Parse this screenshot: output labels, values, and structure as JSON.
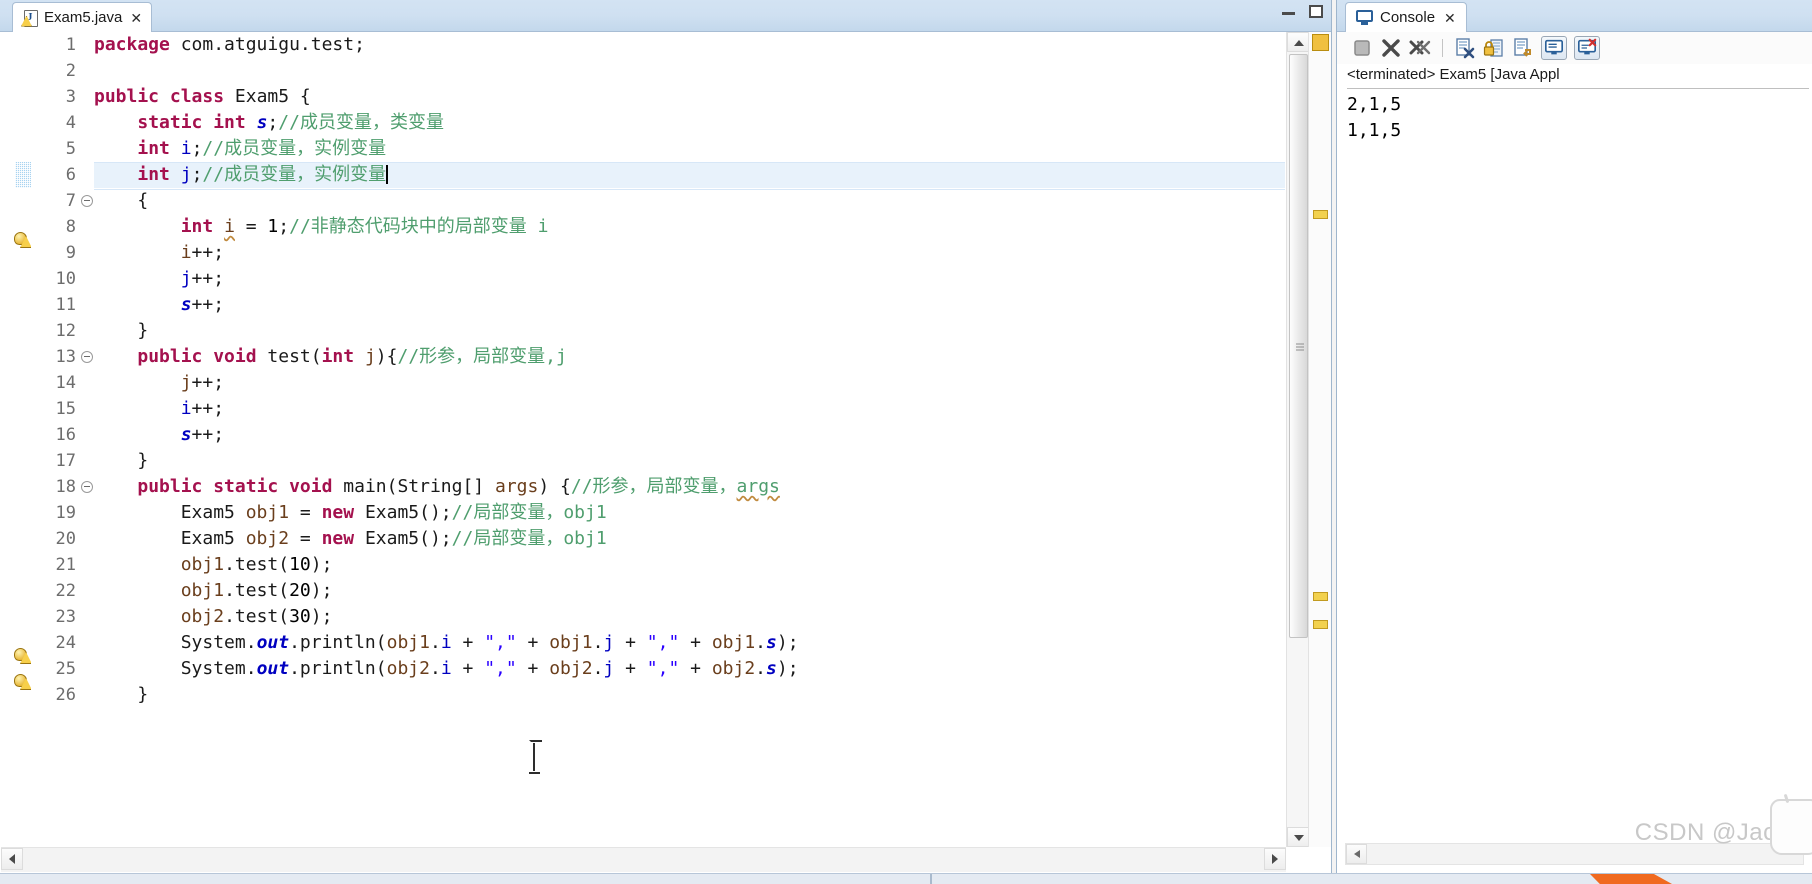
{
  "editor": {
    "tab": {
      "label": "Exam5.java",
      "close_glyph": "✕",
      "icon_letter": "J"
    },
    "window_controls": {
      "minimize": "minimize-icon",
      "maximize": "maximize-icon"
    },
    "line_numbers": [
      "1",
      "2",
      "3",
      "4",
      "5",
      "6",
      "7",
      "8",
      "9",
      "10",
      "11",
      "12",
      "13",
      "14",
      "15",
      "16",
      "17",
      "18",
      "19",
      "20",
      "21",
      "22",
      "23",
      "24",
      "25",
      "26"
    ],
    "lines": [
      {
        "n": "1",
        "tokens": [
          {
            "t": "package ",
            "c": "kw"
          },
          {
            "t": "com.atguigu.test;",
            "c": "plain"
          }
        ]
      },
      {
        "n": "2",
        "tokens": []
      },
      {
        "n": "3",
        "tokens": [
          {
            "t": "public class ",
            "c": "kw"
          },
          {
            "t": "Exam5 {",
            "c": "plain"
          }
        ]
      },
      {
        "n": "4",
        "tokens": [
          {
            "t": "    ",
            "c": "plain"
          },
          {
            "t": "static int ",
            "c": "kw"
          },
          {
            "t": "s",
            "c": "sfld"
          },
          {
            "t": ";",
            "c": "plain"
          },
          {
            "t": "//成员变量，类变量",
            "c": "cmt-cn"
          }
        ]
      },
      {
        "n": "5",
        "tokens": [
          {
            "t": "    ",
            "c": "plain"
          },
          {
            "t": "int ",
            "c": "kw"
          },
          {
            "t": "i",
            "c": "fld"
          },
          {
            "t": ";",
            "c": "plain"
          },
          {
            "t": "//成员变量，实例变量",
            "c": "cmt-cn"
          }
        ]
      },
      {
        "n": "6",
        "tokens": [
          {
            "t": "    ",
            "c": "plain"
          },
          {
            "t": "int ",
            "c": "kw"
          },
          {
            "t": "j",
            "c": "fld"
          },
          {
            "t": ";",
            "c": "plain"
          },
          {
            "t": "//成员变量，实例变量",
            "c": "cmt-cn"
          }
        ],
        "current": true,
        "caret": true
      },
      {
        "n": "7",
        "tokens": [
          {
            "t": "    {",
            "c": "plain"
          }
        ]
      },
      {
        "n": "8",
        "tokens": [
          {
            "t": "        ",
            "c": "plain"
          },
          {
            "t": "int ",
            "c": "kw"
          },
          {
            "t": "i",
            "c": "lvar squiggle"
          },
          {
            "t": " = ",
            "c": "plain"
          },
          {
            "t": "1",
            "c": "num"
          },
          {
            "t": ";",
            "c": "plain"
          },
          {
            "t": "//非静态代码块中的局部变量 i",
            "c": "cmt-cn"
          }
        ]
      },
      {
        "n": "9",
        "tokens": [
          {
            "t": "        ",
            "c": "plain"
          },
          {
            "t": "i",
            "c": "lvar"
          },
          {
            "t": "++;",
            "c": "plain"
          }
        ]
      },
      {
        "n": "10",
        "tokens": [
          {
            "t": "        ",
            "c": "plain"
          },
          {
            "t": "j",
            "c": "fld"
          },
          {
            "t": "++;",
            "c": "plain"
          }
        ]
      },
      {
        "n": "11",
        "tokens": [
          {
            "t": "        ",
            "c": "plain"
          },
          {
            "t": "s",
            "c": "sfld"
          },
          {
            "t": "++;",
            "c": "plain"
          }
        ]
      },
      {
        "n": "12",
        "tokens": [
          {
            "t": "    }",
            "c": "plain"
          }
        ]
      },
      {
        "n": "13",
        "tokens": [
          {
            "t": "    ",
            "c": "plain"
          },
          {
            "t": "public void ",
            "c": "kw"
          },
          {
            "t": "test(",
            "c": "plain"
          },
          {
            "t": "int ",
            "c": "kw"
          },
          {
            "t": "j",
            "c": "lvar"
          },
          {
            "t": "){",
            "c": "plain"
          },
          {
            "t": "//形参，局部变量,j",
            "c": "cmt-cn"
          }
        ]
      },
      {
        "n": "14",
        "tokens": [
          {
            "t": "        ",
            "c": "plain"
          },
          {
            "t": "j",
            "c": "lvar"
          },
          {
            "t": "++;",
            "c": "plain"
          }
        ]
      },
      {
        "n": "15",
        "tokens": [
          {
            "t": "        ",
            "c": "plain"
          },
          {
            "t": "i",
            "c": "fld"
          },
          {
            "t": "++;",
            "c": "plain"
          }
        ]
      },
      {
        "n": "16",
        "tokens": [
          {
            "t": "        ",
            "c": "plain"
          },
          {
            "t": "s",
            "c": "sfld"
          },
          {
            "t": "++;",
            "c": "plain"
          }
        ]
      },
      {
        "n": "17",
        "tokens": [
          {
            "t": "    }",
            "c": "plain"
          }
        ]
      },
      {
        "n": "18",
        "tokens": [
          {
            "t": "    ",
            "c": "plain"
          },
          {
            "t": "public static void ",
            "c": "kw"
          },
          {
            "t": "main(String[] ",
            "c": "plain"
          },
          {
            "t": "args",
            "c": "lvar"
          },
          {
            "t": ") {",
            "c": "plain"
          },
          {
            "t": "//形参，局部变量，",
            "c": "cmt-cn"
          },
          {
            "t": "args",
            "c": "cmt-cn squiggle"
          }
        ]
      },
      {
        "n": "19",
        "tokens": [
          {
            "t": "        Exam5 ",
            "c": "plain"
          },
          {
            "t": "obj1",
            "c": "lvar"
          },
          {
            "t": " = ",
            "c": "plain"
          },
          {
            "t": "new ",
            "c": "kw"
          },
          {
            "t": "Exam5();",
            "c": "plain"
          },
          {
            "t": "//局部变量，obj1",
            "c": "cmt-cn"
          }
        ]
      },
      {
        "n": "20",
        "tokens": [
          {
            "t": "        Exam5 ",
            "c": "plain"
          },
          {
            "t": "obj2",
            "c": "lvar"
          },
          {
            "t": " = ",
            "c": "plain"
          },
          {
            "t": "new ",
            "c": "kw"
          },
          {
            "t": "Exam5();",
            "c": "plain"
          },
          {
            "t": "//局部变量，obj1",
            "c": "cmt-cn"
          }
        ]
      },
      {
        "n": "21",
        "tokens": [
          {
            "t": "        ",
            "c": "plain"
          },
          {
            "t": "obj1",
            "c": "lvar"
          },
          {
            "t": ".test(",
            "c": "plain"
          },
          {
            "t": "10",
            "c": "num"
          },
          {
            "t": ");",
            "c": "plain"
          }
        ]
      },
      {
        "n": "22",
        "tokens": [
          {
            "t": "        ",
            "c": "plain"
          },
          {
            "t": "obj1",
            "c": "lvar"
          },
          {
            "t": ".test(",
            "c": "plain"
          },
          {
            "t": "20",
            "c": "num"
          },
          {
            "t": ");",
            "c": "plain"
          }
        ]
      },
      {
        "n": "23",
        "tokens": [
          {
            "t": "        ",
            "c": "plain"
          },
          {
            "t": "obj2",
            "c": "lvar"
          },
          {
            "t": ".test(",
            "c": "plain"
          },
          {
            "t": "30",
            "c": "num"
          },
          {
            "t": ");",
            "c": "plain"
          }
        ]
      },
      {
        "n": "24",
        "tokens": [
          {
            "t": "        System.",
            "c": "plain"
          },
          {
            "t": "out",
            "c": "sfld"
          },
          {
            "t": ".println(",
            "c": "plain"
          },
          {
            "t": "obj1",
            "c": "lvar"
          },
          {
            "t": ".",
            "c": "plain"
          },
          {
            "t": "i",
            "c": "fld"
          },
          {
            "t": " + ",
            "c": "plain"
          },
          {
            "t": "\",\"",
            "c": "str"
          },
          {
            "t": " + ",
            "c": "plain"
          },
          {
            "t": "obj1",
            "c": "lvar"
          },
          {
            "t": ".",
            "c": "plain"
          },
          {
            "t": "j",
            "c": "fld"
          },
          {
            "t": " + ",
            "c": "plain"
          },
          {
            "t": "\",\"",
            "c": "str"
          },
          {
            "t": " + ",
            "c": "plain"
          },
          {
            "t": "obj1",
            "c": "lvar"
          },
          {
            "t": ".",
            "c": "plain"
          },
          {
            "t": "s",
            "c": "sfld"
          },
          {
            "t": ");",
            "c": "plain"
          }
        ]
      },
      {
        "n": "25",
        "tokens": [
          {
            "t": "        System.",
            "c": "plain"
          },
          {
            "t": "out",
            "c": "sfld"
          },
          {
            "t": ".println(",
            "c": "plain"
          },
          {
            "t": "obj2",
            "c": "lvar"
          },
          {
            "t": ".",
            "c": "plain"
          },
          {
            "t": "i",
            "c": "fld"
          },
          {
            "t": " + ",
            "c": "plain"
          },
          {
            "t": "\",\"",
            "c": "str"
          },
          {
            "t": " + ",
            "c": "plain"
          },
          {
            "t": "obj2",
            "c": "lvar"
          },
          {
            "t": ".",
            "c": "plain"
          },
          {
            "t": "j",
            "c": "fld"
          },
          {
            "t": " + ",
            "c": "plain"
          },
          {
            "t": "\",\"",
            "c": "str"
          },
          {
            "t": " + ",
            "c": "plain"
          },
          {
            "t": "obj2",
            "c": "lvar"
          },
          {
            "t": ".",
            "c": "plain"
          },
          {
            "t": "s",
            "c": "sfld"
          },
          {
            "t": ");",
            "c": "plain"
          }
        ]
      },
      {
        "n": "26",
        "tokens": [
          {
            "t": "    }",
            "c": "plain"
          }
        ]
      }
    ],
    "fold_lines": [
      "7",
      "13",
      "18"
    ],
    "warning_lines": [
      "8",
      "24",
      "25"
    ],
    "changed_line": "6"
  },
  "console": {
    "tab": {
      "label": "Console",
      "close_glyph": "✕"
    },
    "toolbar": [
      "terminate-icon",
      "remove-launch-icon",
      "remove-all-terminated-icon",
      "separator",
      "clear-console-icon",
      "scroll-lock-icon",
      "word-wrap-icon",
      "display-selected-console-icon",
      "open-console-icon"
    ],
    "terminated_label": "<terminated> Exam5 [Java Appl",
    "output": [
      "2,1,5",
      "1,1,5"
    ]
  },
  "watermark": {
    "text": "CSDN @Jacko"
  },
  "colors": {
    "keyword": "#a4114e",
    "comment": "#41a05e",
    "string": "#2a00ff",
    "field": "#0000c0",
    "local_var": "#6a3e1c",
    "tab_bar": "#cfe0f1",
    "current_line": "#e8f2fb"
  }
}
